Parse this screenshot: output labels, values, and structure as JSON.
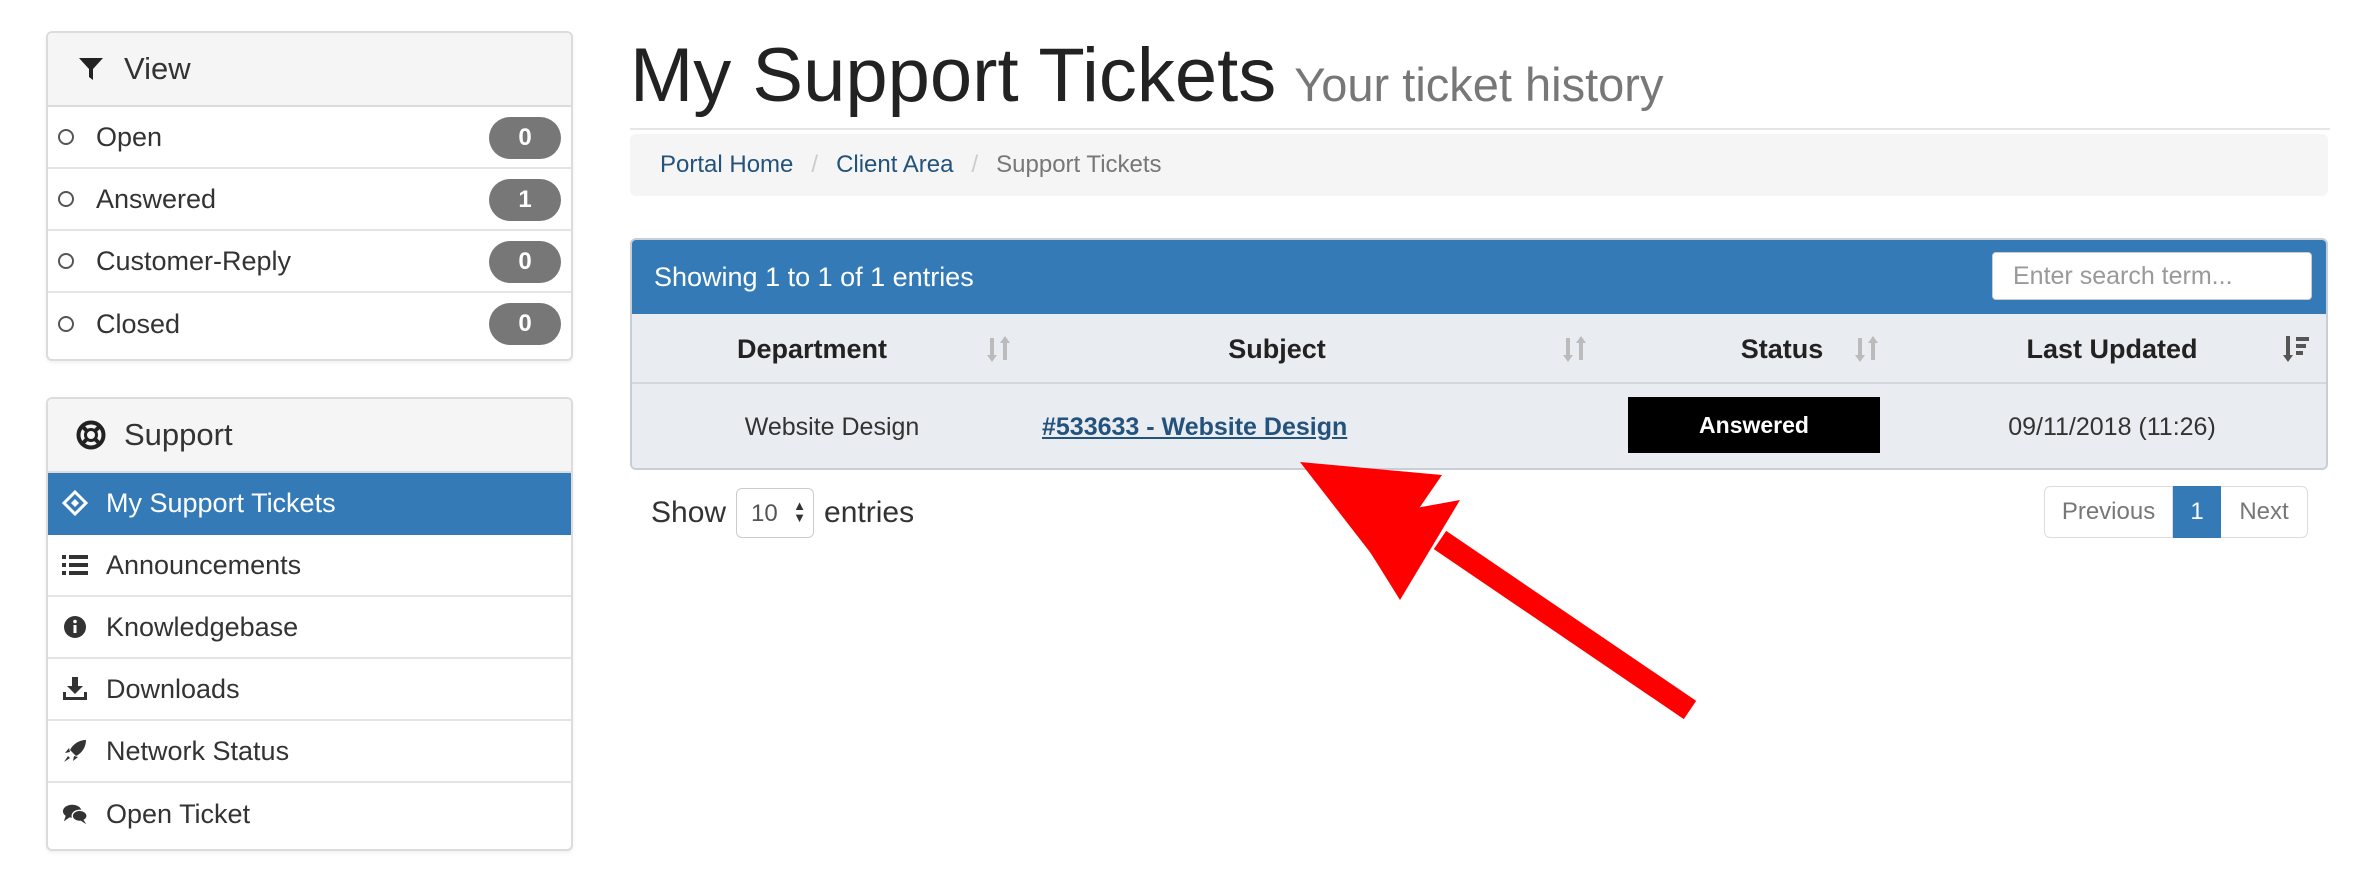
{
  "sidebar": {
    "view": {
      "title": "View",
      "icon": "filter-icon",
      "items": [
        {
          "label": "Open",
          "count": "0"
        },
        {
          "label": "Answered",
          "count": "1"
        },
        {
          "label": "Customer-Reply",
          "count": "0"
        },
        {
          "label": "Closed",
          "count": "0"
        }
      ]
    },
    "support": {
      "title": "Support",
      "icon": "life-ring-icon",
      "items": [
        {
          "label": "My Support Tickets",
          "icon": "ticket-icon",
          "active": true
        },
        {
          "label": "Announcements",
          "icon": "list-icon"
        },
        {
          "label": "Knowledgebase",
          "icon": "info-circle-icon"
        },
        {
          "label": "Downloads",
          "icon": "download-icon"
        },
        {
          "label": "Network Status",
          "icon": "rocket-icon"
        },
        {
          "label": "Open Ticket",
          "icon": "comments-icon"
        }
      ]
    }
  },
  "page": {
    "title": "My Support Tickets",
    "subtitle": "Your ticket history"
  },
  "breadcrumb": {
    "items": [
      "Portal Home",
      "Client Area"
    ],
    "current": "Support Tickets"
  },
  "table": {
    "info": "Showing 1 to 1 of 1 entries",
    "search_placeholder": "Enter search term...",
    "columns": [
      "Department",
      "Subject",
      "Status",
      "Last Updated"
    ],
    "rows": [
      {
        "department": "Website Design",
        "subject": "#533633 - Website Design",
        "status": "Answered",
        "last_updated": "09/11/2018 (11:26)"
      }
    ],
    "show_label": "Show",
    "entries_label": "entries",
    "page_size": "10"
  },
  "pagination": {
    "previous": "Previous",
    "current": "1",
    "next": "Next"
  },
  "colors": {
    "primary": "#337ab7",
    "badge": "#777777",
    "status_bg": "#000000",
    "annotation_arrow": "#ff0000"
  }
}
